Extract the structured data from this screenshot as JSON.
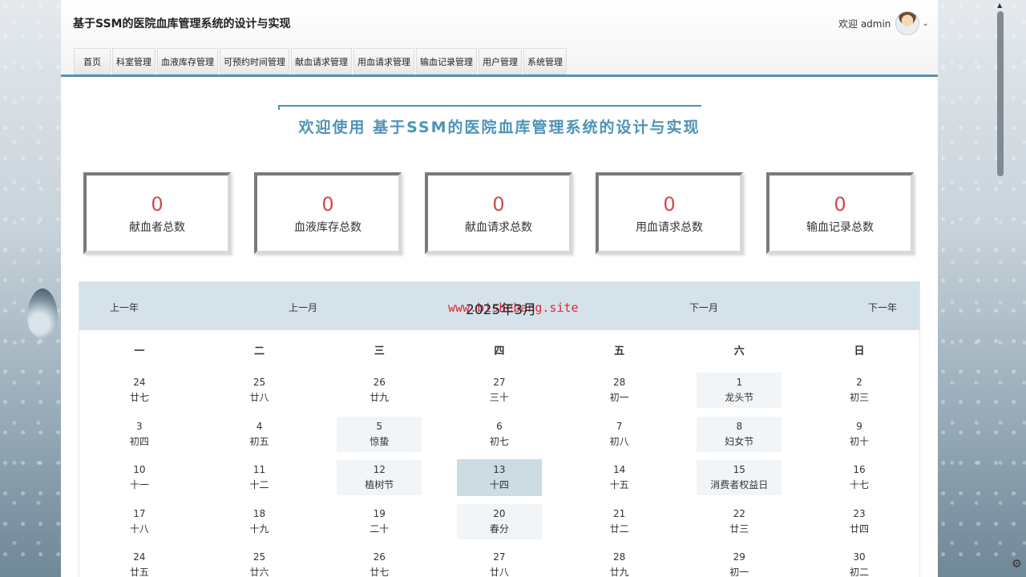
{
  "app": {
    "title": "基于SSM的医院血库管理系统的设计与实现",
    "welcome": "欢迎 admin"
  },
  "nav": [
    {
      "label": "首页"
    },
    {
      "label": "科室管理"
    },
    {
      "label": "血液库存管理"
    },
    {
      "label": "可预约时间管理"
    },
    {
      "label": "献血请求管理"
    },
    {
      "label": "用血请求管理"
    },
    {
      "label": "输血记录管理"
    },
    {
      "label": "用户管理"
    },
    {
      "label": "系统管理"
    }
  ],
  "banner": {
    "text": "欢迎使用 基于SSM的医院血库管理系统的设计与实现"
  },
  "stats": [
    {
      "value": "0",
      "label": "献血者总数"
    },
    {
      "value": "0",
      "label": "血液库存总数"
    },
    {
      "value": "0",
      "label": "献血请求总数"
    },
    {
      "value": "0",
      "label": "用血请求总数"
    },
    {
      "value": "0",
      "label": "输血记录总数"
    }
  ],
  "calendar": {
    "prev_year": "上一年",
    "prev_month": "上一月",
    "month": "2025年3月",
    "next_month": "下一月",
    "next_year": "下一年",
    "watermark": "www.bishebang.site",
    "weekdays": [
      "一",
      "二",
      "三",
      "四",
      "五",
      "六",
      "日"
    ],
    "weeks": [
      [
        {
          "d": "24",
          "l": "廿七"
        },
        {
          "d": "25",
          "l": "廿八"
        },
        {
          "d": "26",
          "l": "廿九"
        },
        {
          "d": "27",
          "l": "三十"
        },
        {
          "d": "28",
          "l": "初一"
        },
        {
          "d": "1",
          "l": "龙头节",
          "festival": true
        },
        {
          "d": "2",
          "l": "初三"
        }
      ],
      [
        {
          "d": "3",
          "l": "初四"
        },
        {
          "d": "4",
          "l": "初五"
        },
        {
          "d": "5",
          "l": "惊蛰",
          "festival": true
        },
        {
          "d": "6",
          "l": "初七"
        },
        {
          "d": "7",
          "l": "初八"
        },
        {
          "d": "8",
          "l": "妇女节",
          "festival": true
        },
        {
          "d": "9",
          "l": "初十"
        }
      ],
      [
        {
          "d": "10",
          "l": "十一"
        },
        {
          "d": "11",
          "l": "十二"
        },
        {
          "d": "12",
          "l": "植树节",
          "festival": true
        },
        {
          "d": "13",
          "l": "十四",
          "today": true
        },
        {
          "d": "14",
          "l": "十五"
        },
        {
          "d": "15",
          "l": "消费者权益日",
          "festival": true
        },
        {
          "d": "16",
          "l": "十七"
        }
      ],
      [
        {
          "d": "17",
          "l": "十八"
        },
        {
          "d": "18",
          "l": "十九"
        },
        {
          "d": "19",
          "l": "二十"
        },
        {
          "d": "20",
          "l": "春分",
          "festival": true
        },
        {
          "d": "21",
          "l": "廿二"
        },
        {
          "d": "22",
          "l": "廿三"
        },
        {
          "d": "23",
          "l": "廿四"
        }
      ],
      [
        {
          "d": "24",
          "l": "廿五"
        },
        {
          "d": "25",
          "l": "廿六"
        },
        {
          "d": "26",
          "l": "廿七"
        },
        {
          "d": "27",
          "l": "廿八"
        },
        {
          "d": "28",
          "l": "廿九"
        },
        {
          "d": "29",
          "l": "初一"
        },
        {
          "d": "30",
          "l": "初二"
        }
      ]
    ]
  }
}
